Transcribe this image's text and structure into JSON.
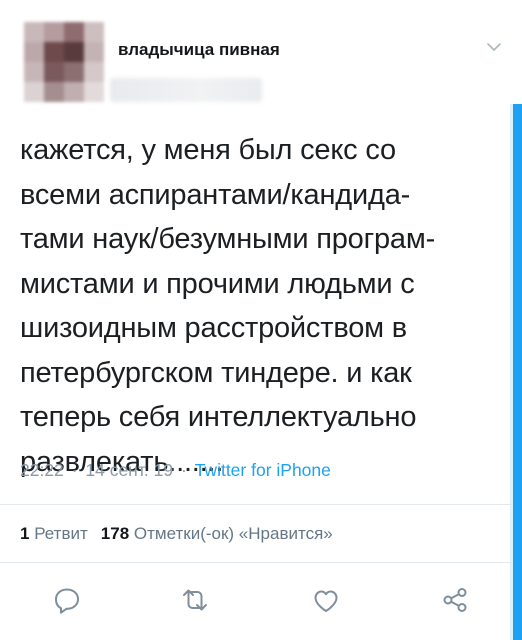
{
  "tweet": {
    "author_name": "владычица пивная",
    "text_lines": [
      "кажется, у меня был секс со",
      "всеми аспирантами/кандида-",
      "тами наук/безумными програм-",
      "мистами и прочими людьми с",
      "шизоидным расстройством в",
      "петербургском тиндере. и как",
      "теперь себя интеллектуально",
      "развлекать......."
    ],
    "time": "22:22",
    "date": "14 сент. 19",
    "separator": "·",
    "source": "Twitter for iPhone"
  },
  "stats": {
    "retweet_count": "1",
    "retweet_label": "Ретвит",
    "like_count": "178",
    "like_label": "Отметки(-ок) «Нравится»"
  },
  "actions": {
    "icons": [
      "reply-icon",
      "retweet-icon",
      "like-icon",
      "share-icon"
    ]
  },
  "colors": {
    "accent": "#1da1f2",
    "meta_text": "#8a9aa7",
    "divider": "#e3e8ec"
  }
}
